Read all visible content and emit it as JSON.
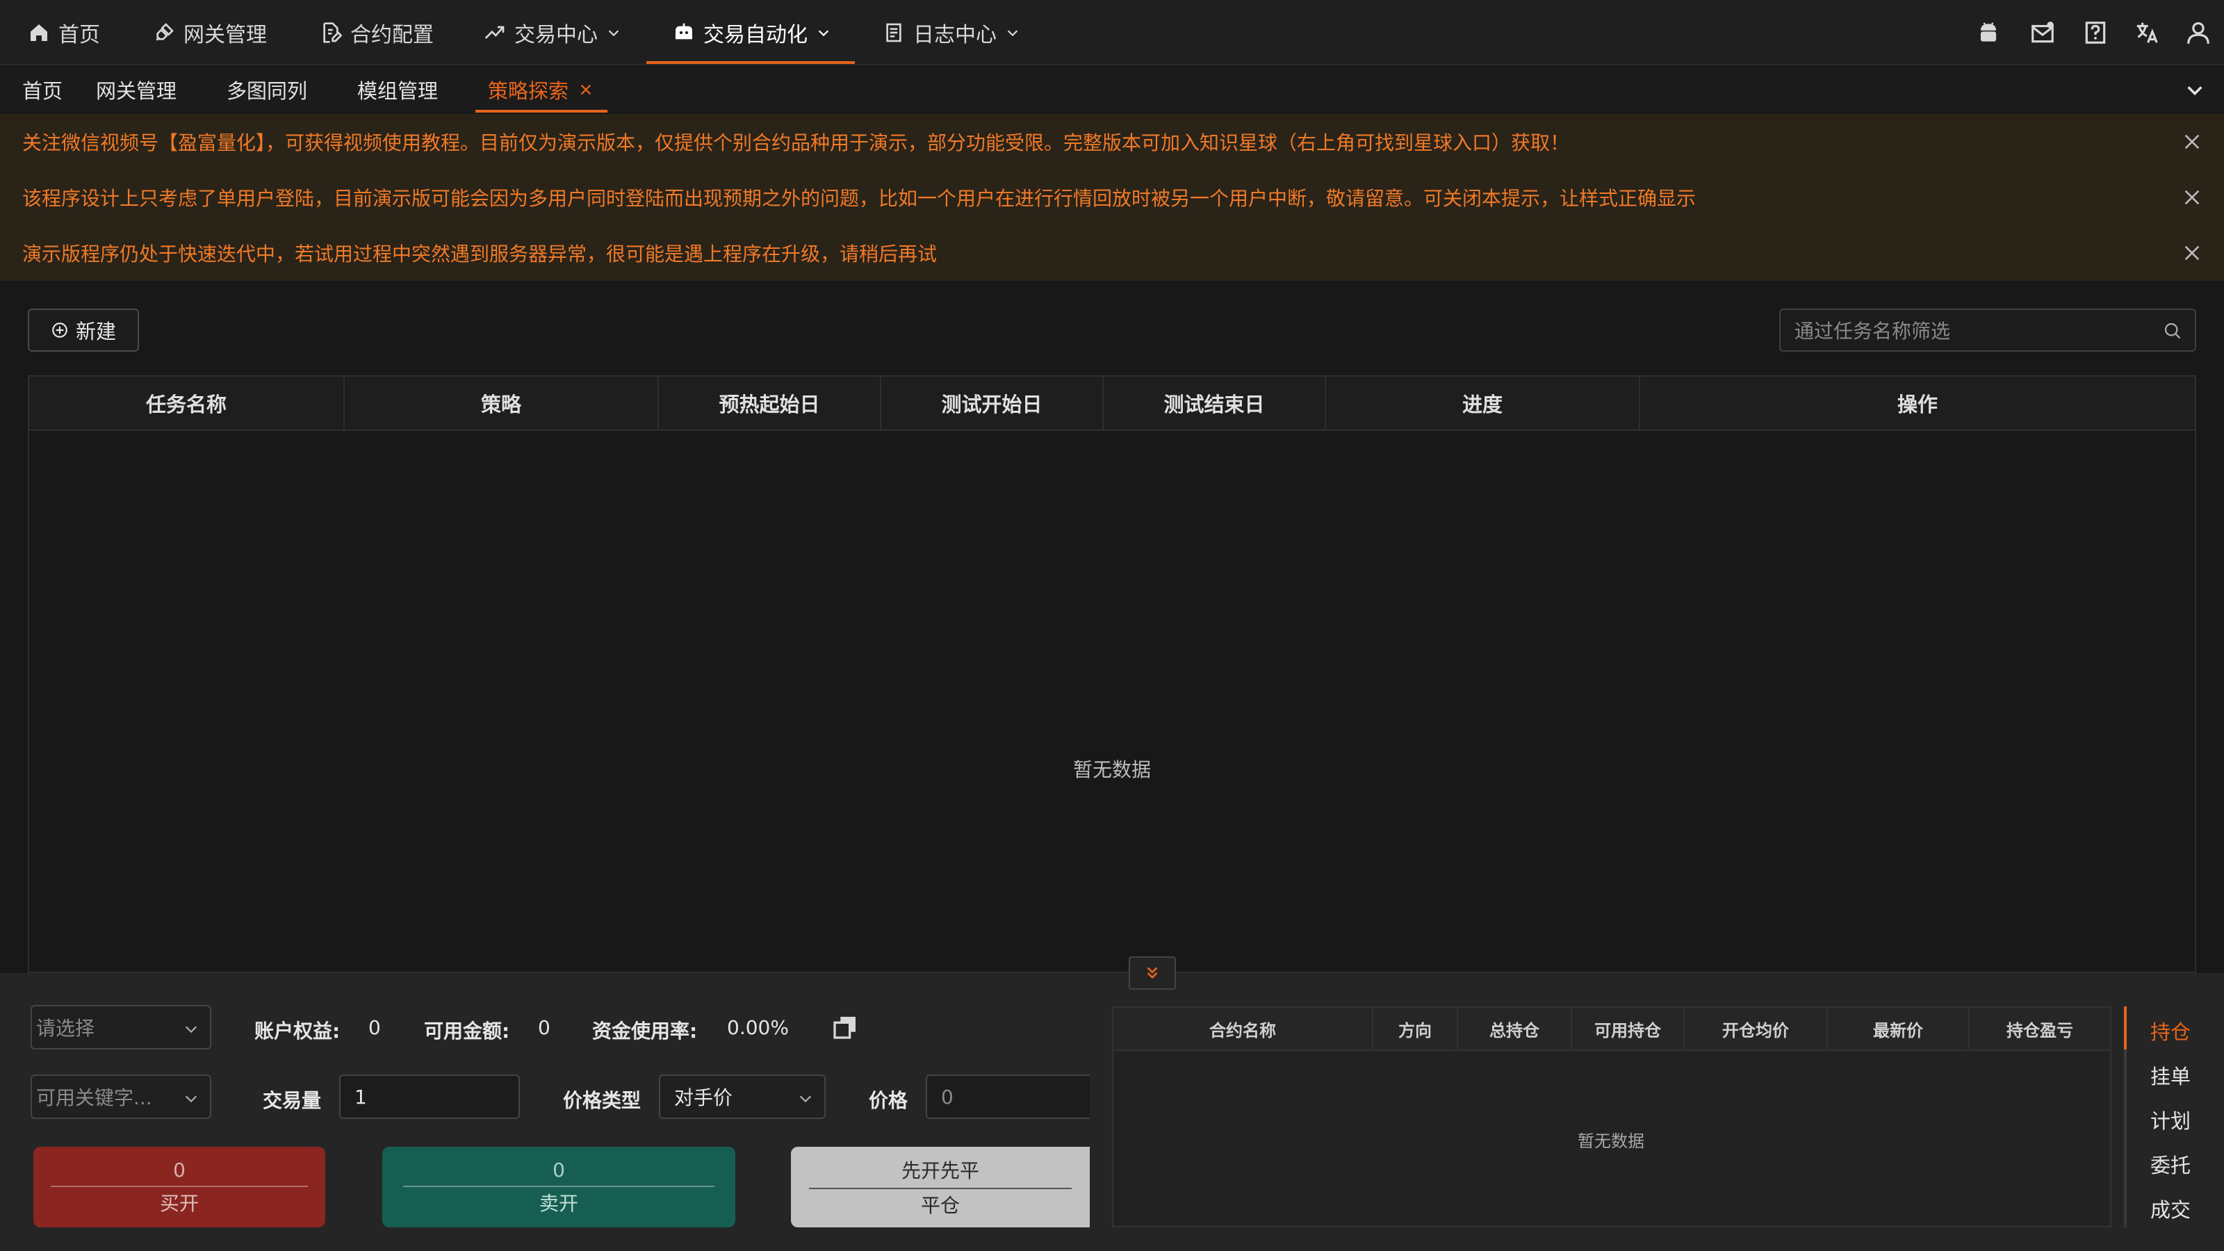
{
  "nav": {
    "items": [
      {
        "label": "首页",
        "icon": "home-icon"
      },
      {
        "label": "网关管理",
        "icon": "plug-icon"
      },
      {
        "label": "合约配置",
        "icon": "file-edit-icon"
      },
      {
        "label": "交易中心",
        "icon": "trend-icon"
      },
      {
        "label": "交易自动化",
        "icon": "robot-icon"
      },
      {
        "label": "日志中心",
        "icon": "document-icon"
      }
    ],
    "active_index": 4,
    "right_icons": [
      "android-icon",
      "mail-icon",
      "help-icon",
      "translate-icon",
      "user-icon"
    ]
  },
  "tabs": {
    "items": [
      "首页",
      "网关管理",
      "多图同列",
      "模组管理",
      "策略探索"
    ],
    "active_index": 4
  },
  "notices": [
    "关注微信视频号【盈富量化】，可获得视频使用教程。目前仅为演示版本，仅提供个别合约品种用于演示，部分功能受限。完整版本可加入知识星球（右上角可找到星球入口）获取！",
    "该程序设计上只考虑了单用户登陆，目前演示版可能会因为多用户同时登陆而出现预期之外的问题，比如一个用户在进行行情回放时被另一个用户中断，敬请留意。可关闭本提示，让样式正确显示",
    "演示版程序仍处于快速迭代中，若试用过程中突然遇到服务器异常，很可能是遇上程序在升级，请稍后再试"
  ],
  "toolbar": {
    "new_label": "新建",
    "filter_placeholder": "通过任务名称筛选"
  },
  "task_table": {
    "columns": [
      "任务名称",
      "策略",
      "预热起始日",
      "测试开始日",
      "测试结束日",
      "进度",
      "操作"
    ],
    "empty_text": "暂无数据"
  },
  "account": {
    "account_select_placeholder": "请选择",
    "equity_label": "账户权益:",
    "equity_value": "0",
    "available_label": "可用金额:",
    "available_value": "0",
    "usage_label": "资金使用率:",
    "usage_value": "0.00%"
  },
  "order": {
    "contract_select_placeholder": "可用关键字...",
    "volume_label": "交易量",
    "volume_value": "1",
    "price_type_label": "价格类型",
    "price_type_value": "对手价",
    "price_label": "价格",
    "price_placeholder": "0"
  },
  "buttons": {
    "buy": {
      "top": "0",
      "label": "买开",
      "color": "#8b2520"
    },
    "sell": {
      "top": "0",
      "label": "卖开",
      "color": "#175e52"
    },
    "close": {
      "top": "先开先平",
      "label": "平仓",
      "color": "#c2c2c2"
    }
  },
  "positions": {
    "columns": [
      "合约名称",
      "方向",
      "总持仓",
      "可用持仓",
      "开仓均价",
      "最新价",
      "持仓盈亏"
    ],
    "empty_text": "暂无数据"
  },
  "side_tabs": {
    "items": [
      "持仓",
      "挂单",
      "计划",
      "委托",
      "成交"
    ],
    "active_index": 0
  },
  "colors": {
    "accent": "#e8641b",
    "notice_text": "#f07a28"
  }
}
